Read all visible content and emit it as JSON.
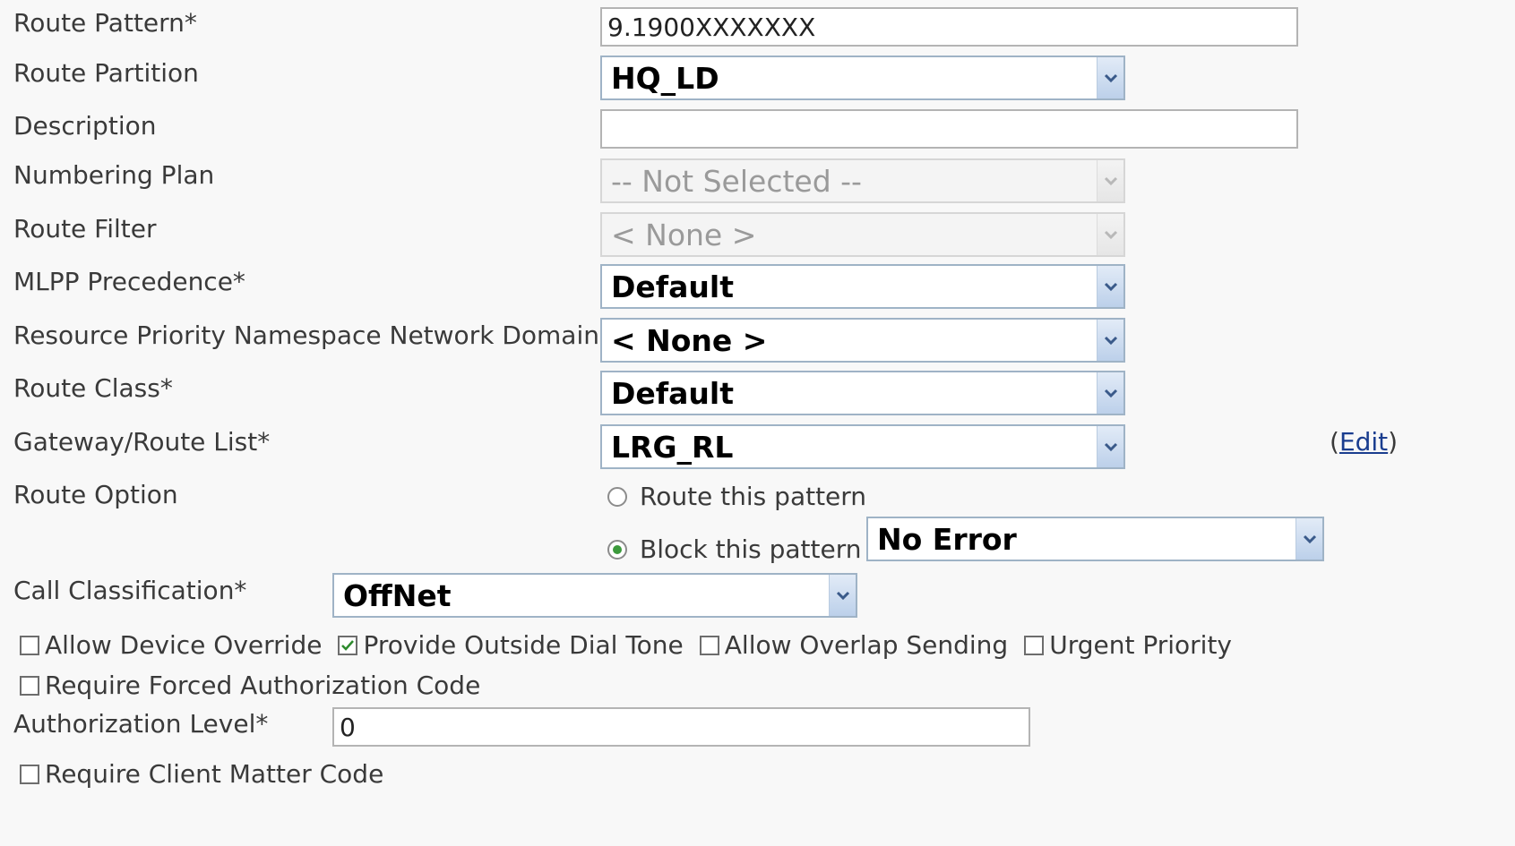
{
  "fields": {
    "route_pattern": {
      "label": "Route Pattern*",
      "value": "9.1900XXXXXXX"
    },
    "route_partition": {
      "label": "Route Partition",
      "value": "HQ_LD"
    },
    "description": {
      "label": "Description",
      "value": ""
    },
    "numbering_plan": {
      "label": "Numbering Plan",
      "value": "-- Not Selected --"
    },
    "route_filter": {
      "label": "Route Filter",
      "value": "< None >"
    },
    "mlpp_precedence": {
      "label": "MLPP Precedence*",
      "value": "Default"
    },
    "resource_priority": {
      "label": "Resource Priority Namespace Network Domain",
      "value": "< None >"
    },
    "route_class": {
      "label": "Route Class*",
      "value": "Default"
    },
    "gateway_route_list": {
      "label": "Gateway/Route List*",
      "value": "LRG_RL",
      "edit_link": "Edit",
      "paren_open": "(",
      "paren_close": ")"
    },
    "route_option": {
      "label": "Route Option",
      "option_route": "Route this pattern",
      "option_block": "Block this pattern",
      "selected": "block",
      "block_reason": "No Error"
    },
    "call_classification": {
      "label": "Call Classification*",
      "value": "OffNet"
    },
    "authorization_level": {
      "label": "Authorization Level*",
      "value": "0"
    }
  },
  "checkboxes": {
    "allow_device_override": {
      "label": "Allow Device Override",
      "checked": false
    },
    "provide_outside_dial_tone": {
      "label": "Provide Outside Dial Tone",
      "checked": true
    },
    "allow_overlap_sending": {
      "label": "Allow Overlap Sending",
      "checked": false
    },
    "urgent_priority": {
      "label": "Urgent Priority",
      "checked": false
    },
    "require_forced_auth_code": {
      "label": "Require Forced Authorization Code",
      "checked": false
    },
    "require_client_matter_code": {
      "label": "Require Client Matter Code",
      "checked": false
    }
  },
  "icons": {
    "dropdown": "chevron-down-icon",
    "check": "checkmark-icon"
  },
  "colors": {
    "background": "#f8f8f8",
    "link": "#1a3d8f",
    "radio_selected": "#3c9a3c",
    "dropdown_button": "#c9d9ef"
  }
}
